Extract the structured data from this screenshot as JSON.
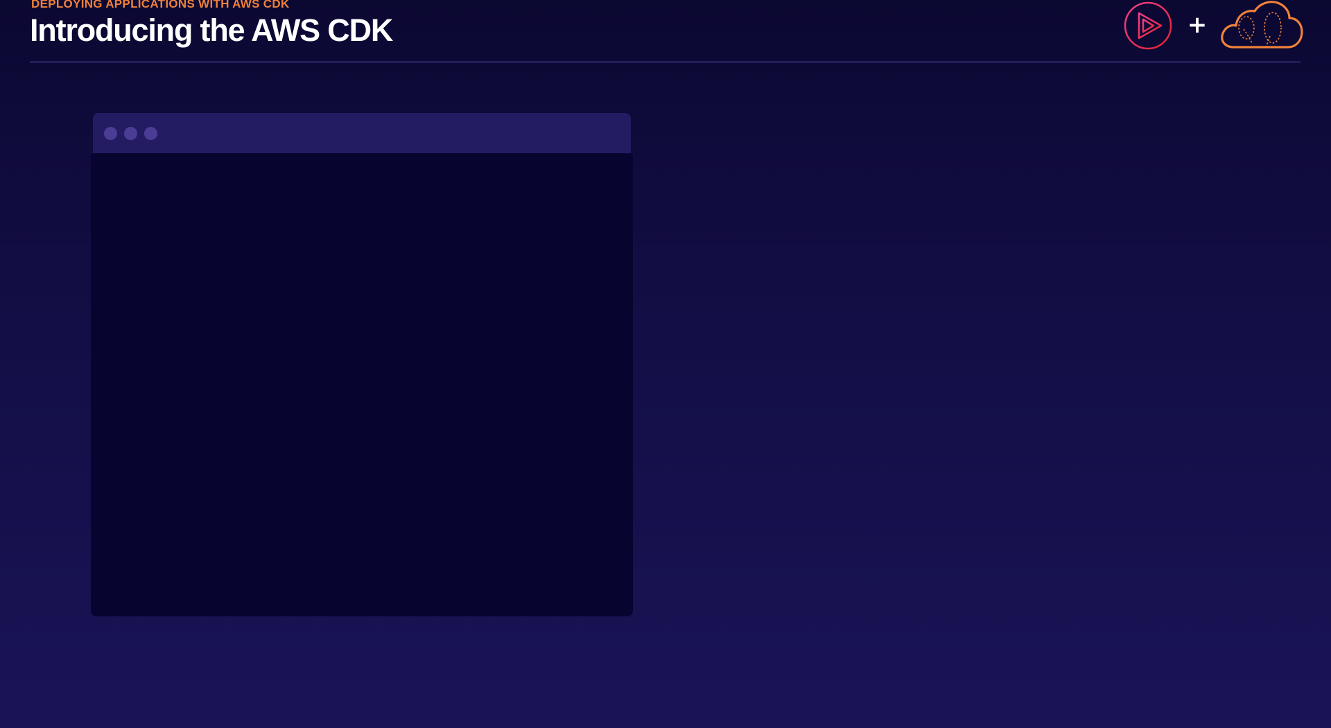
{
  "slide": {
    "kicker": "DEPLOYING APPLICATIONS WITH AWS CDK",
    "title": "Introducing the AWS CDK"
  },
  "logos": {
    "play_icon": "pluralsight-play-icon",
    "plus_text": "+",
    "cloud_icon": "cloud-guru-cloud-icon"
  },
  "terminal": {
    "dots": [
      "dot-1",
      "dot-2",
      "dot-3"
    ],
    "content": ""
  },
  "colors": {
    "accent_orange": "#f0813a",
    "accent_magenta": "#e6265a",
    "title_text": "#ffffff",
    "terminal_bar": "#241c63",
    "terminal_body": "#070430",
    "background_top": "#0b0832",
    "background_bottom": "#1a1456"
  }
}
